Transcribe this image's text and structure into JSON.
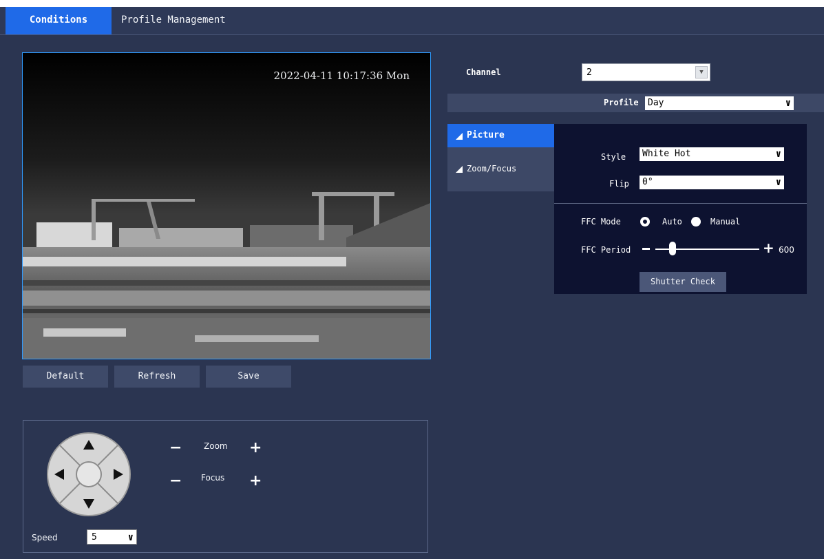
{
  "tabs": [
    {
      "label": "Conditions",
      "active": true
    },
    {
      "label": "Profile Management",
      "active": false
    }
  ],
  "video": {
    "timestamp": "2022-04-11 10:17:36 Mon"
  },
  "buttons": {
    "default": "Default",
    "refresh": "Refresh",
    "save": "Save"
  },
  "ptz": {
    "zoom_label": "Zoom",
    "focus_label": "Focus",
    "minus": "−",
    "plus": "+",
    "speed_label": "Speed",
    "speed_value": "5"
  },
  "settings": {
    "channel_label": "Channel",
    "channel_value": "2",
    "profile_label": "Profile",
    "profile_value": "Day",
    "nav": {
      "picture": "Picture",
      "zoom_focus": "Zoom/Focus"
    },
    "style_label": "Style",
    "style_value": "White Hot",
    "flip_label": "Flip",
    "flip_value": "0°",
    "ffc_mode_label": "FFC Mode",
    "ffc_mode_auto": "Auto",
    "ffc_mode_manual": "Manual",
    "ffc_mode_selected": "Auto",
    "ffc_period_label": "FFC Period",
    "ffc_period_value": "600",
    "shutter_check": "Shutter Check"
  },
  "colors": {
    "accent": "#1f6ae8",
    "background": "#2b3551",
    "panel": "#0d1230"
  }
}
